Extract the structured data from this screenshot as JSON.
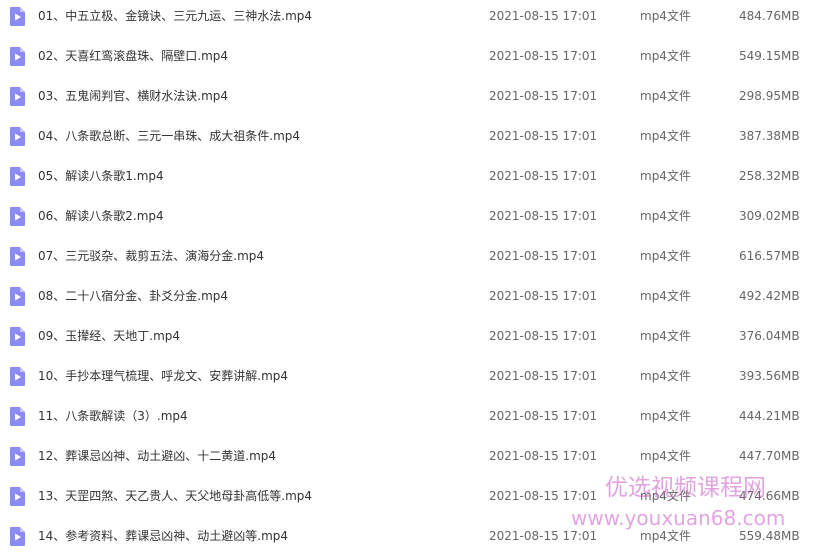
{
  "file_list": {
    "file_type_icon": "video-file-icon",
    "icon_color": "#8c8cf0",
    "rows": [
      {
        "name": "01、中五立极、金镜诀、三元九运、三神水法.mp4",
        "date": "2021-08-15 17:01",
        "type": "mp4文件",
        "size": "484.76MB"
      },
      {
        "name": "02、天喜红鸾滚盘珠、隔壁口.mp4",
        "date": "2021-08-15 17:01",
        "type": "mp4文件",
        "size": "549.15MB"
      },
      {
        "name": "03、五鬼闹判官、横财水法诀.mp4",
        "date": "2021-08-15 17:01",
        "type": "mp4文件",
        "size": "298.95MB"
      },
      {
        "name": "04、八条歌总断、三元一串珠、成大祖条件.mp4",
        "date": "2021-08-15 17:01",
        "type": "mp4文件",
        "size": "387.38MB"
      },
      {
        "name": "05、解读八条歌1.mp4",
        "date": "2021-08-15 17:01",
        "type": "mp4文件",
        "size": "258.32MB"
      },
      {
        "name": "06、解读八条歌2.mp4",
        "date": "2021-08-15 17:01",
        "type": "mp4文件",
        "size": "309.02MB"
      },
      {
        "name": "07、三元驳杂、裁剪五法、演海分金.mp4",
        "date": "2021-08-15 17:01",
        "type": "mp4文件",
        "size": "616.57MB"
      },
      {
        "name": "08、二十八宿分金、卦爻分金.mp4",
        "date": "2021-08-15 17:01",
        "type": "mp4文件",
        "size": "492.42MB"
      },
      {
        "name": "09、玉撵经、天地丁.mp4",
        "date": "2021-08-15 17:01",
        "type": "mp4文件",
        "size": "376.04MB"
      },
      {
        "name": "10、手抄本理气梳理、呼龙文、安葬讲解.mp4",
        "date": "2021-08-15 17:01",
        "type": "mp4文件",
        "size": "393.56MB"
      },
      {
        "name": "11、八条歌解读（3）.mp4",
        "date": "2021-08-15 17:01",
        "type": "mp4文件",
        "size": "444.21MB"
      },
      {
        "name": "12、葬课忌凶神、动土避凶、十二黄道.mp4",
        "date": "2021-08-15 17:01",
        "type": "mp4文件",
        "size": "447.70MB"
      },
      {
        "name": "13、天罡四煞、天乙贵人、天父地母卦高低等.mp4",
        "date": "2021-08-15 17:01",
        "type": "mp4文件",
        "size": "474.66MB"
      },
      {
        "name": "14、参考资料、葬课忌凶神、动土避凶等.mp4",
        "date": "2021-08-15 17:01",
        "type": "mp4文件",
        "size": "559.48MB"
      }
    ]
  },
  "watermark": {
    "title": "优选视频课程网",
    "url": "www.youxuan68.com"
  }
}
